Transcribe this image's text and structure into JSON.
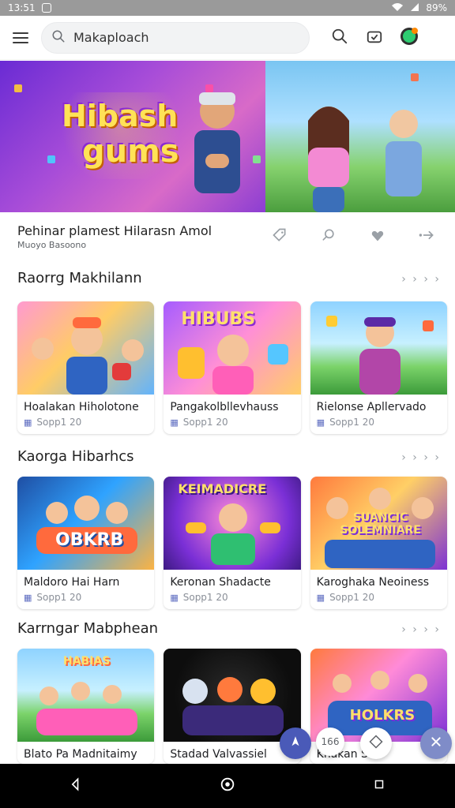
{
  "status": {
    "time": "13:51",
    "battery": "89%"
  },
  "search": {
    "value": "Makaploach"
  },
  "hero": {
    "logo_line1": "Hibash",
    "logo_line2": "gums"
  },
  "feature": {
    "title": "Pehinar plamest Hilarasn Amol",
    "subtitle": "Muoyo Basoono"
  },
  "sections": [
    {
      "title": "Raorrg Makhilann",
      "more": "› › › ›",
      "items": [
        {
          "title": "Hoalakan Hiholotone",
          "meta": "Sopp1 20",
          "thumb_text": ""
        },
        {
          "title": "Pangakolbllevhauss",
          "meta": "Sopp1 20",
          "thumb_text": "HIBUBS"
        },
        {
          "title": "Rielonse Apllervado",
          "meta": "Sopp1 20",
          "thumb_text": ""
        }
      ]
    },
    {
      "title": "Kaorga Hibarhcs",
      "more": "› › › ›",
      "items": [
        {
          "title": "Maldoro Hai Harn",
          "meta": "Sopp1 20",
          "thumb_text": "OBKRB"
        },
        {
          "title": "Keronan Shadacte",
          "meta": "Sopp1 20",
          "thumb_text": "KEIMADICRE"
        },
        {
          "title": "Karoghaka Neoiness",
          "meta": "Sopp1 20",
          "thumb_text": "SUANCIC SOLEMNIARE"
        }
      ]
    },
    {
      "title": "Karrngar Mabphean",
      "more": "› › › ›",
      "items": [
        {
          "title": "Blato Pa Madnitaimy",
          "meta": "",
          "thumb_text": "HABIAS"
        },
        {
          "title": "Stadad Valvassiel",
          "meta": "",
          "thumb_text": ""
        },
        {
          "title": "Knakan Slair",
          "meta": "",
          "thumb_text": "HOLKRS"
        }
      ]
    }
  ],
  "floating": {
    "badge": "166"
  },
  "colors": {
    "accent": "#5c6bc0",
    "hero_purple": "#7a2fd6",
    "hero_sky": "#8ed3ff"
  }
}
